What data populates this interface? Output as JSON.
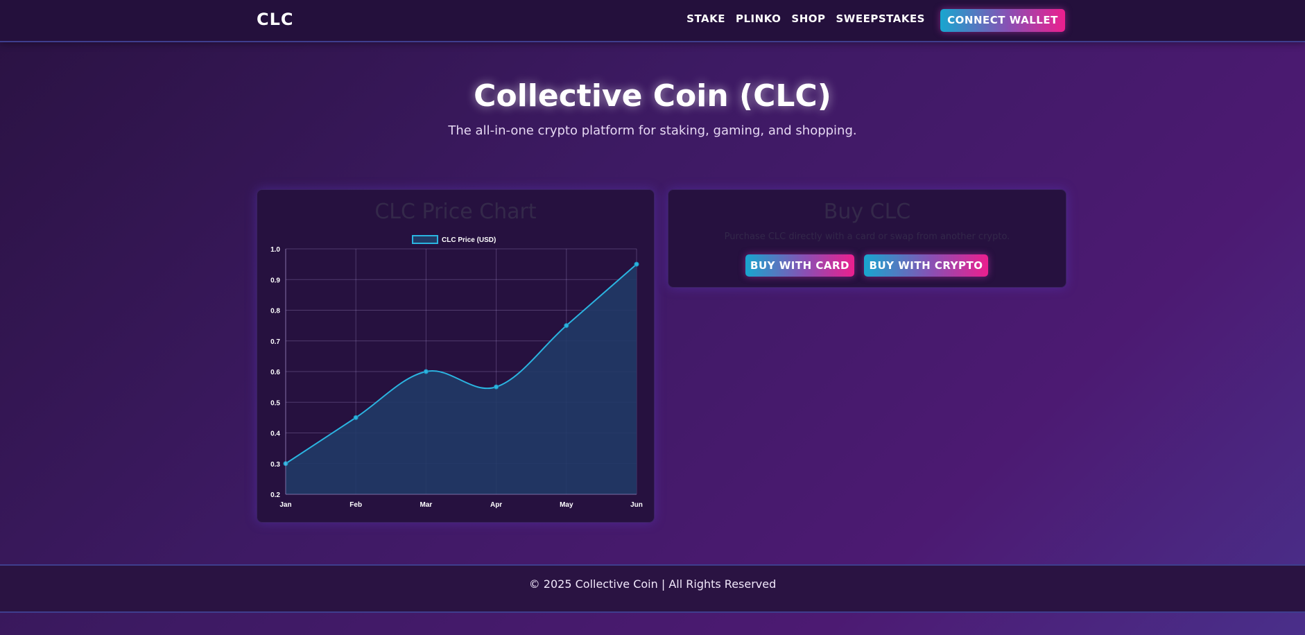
{
  "header": {
    "logo": "CLC",
    "nav": [
      "STAKE",
      "PLINKO",
      "SHOP",
      "SWEEPSTAKES"
    ],
    "connect_label": "CONNECT WALLET"
  },
  "hero": {
    "title": "Collective Coin (CLC)",
    "subtitle": "The all-in-one crypto platform for staking, gaming, and shopping."
  },
  "chart_card": {
    "title": "CLC Price Chart"
  },
  "buy_card": {
    "title": "Buy CLC",
    "description": "Purchase CLC directly with a card or swap from another crypto.",
    "buy_card_label": "BUY WITH CARD",
    "buy_crypto_label": "BUY WITH CRYPTO"
  },
  "footer": {
    "text": "© 2025 Collective Coin | All Rights Reserved"
  },
  "colors": {
    "accent_cyan": "#18a6cf",
    "accent_pink": "#ec1f8e",
    "line": "#2bb4e0",
    "fill": "#213a66"
  },
  "chart_data": {
    "type": "line",
    "categories": [
      "Jan",
      "Feb",
      "Mar",
      "Apr",
      "May",
      "Jun"
    ],
    "series": [
      {
        "name": "CLC Price (USD)",
        "values": [
          0.3,
          0.45,
          0.6,
          0.55,
          0.75,
          0.95
        ]
      }
    ],
    "ylim": [
      0.2,
      1.0
    ],
    "yticks": [
      "0.2",
      "0.3",
      "0.4",
      "0.5",
      "0.6",
      "0.7",
      "0.8",
      "0.9",
      "1.0"
    ],
    "fill": true,
    "grid": true,
    "legend": "top"
  }
}
